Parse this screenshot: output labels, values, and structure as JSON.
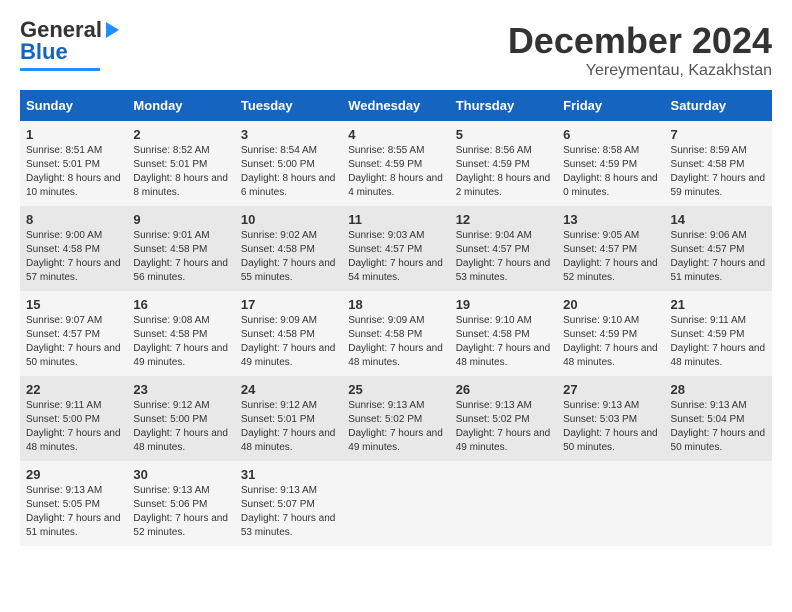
{
  "header": {
    "logo_general": "General",
    "logo_blue": "Blue",
    "month": "December 2024",
    "location": "Yereymentau, Kazakhstan"
  },
  "weekdays": [
    "Sunday",
    "Monday",
    "Tuesday",
    "Wednesday",
    "Thursday",
    "Friday",
    "Saturday"
  ],
  "weeks": [
    [
      {
        "day": "1",
        "sunrise": "8:51 AM",
        "sunset": "5:01 PM",
        "daylight": "8 hours and 10 minutes."
      },
      {
        "day": "2",
        "sunrise": "8:52 AM",
        "sunset": "5:01 PM",
        "daylight": "8 hours and 8 minutes."
      },
      {
        "day": "3",
        "sunrise": "8:54 AM",
        "sunset": "5:00 PM",
        "daylight": "8 hours and 6 minutes."
      },
      {
        "day": "4",
        "sunrise": "8:55 AM",
        "sunset": "4:59 PM",
        "daylight": "8 hours and 4 minutes."
      },
      {
        "day": "5",
        "sunrise": "8:56 AM",
        "sunset": "4:59 PM",
        "daylight": "8 hours and 2 minutes."
      },
      {
        "day": "6",
        "sunrise": "8:58 AM",
        "sunset": "4:59 PM",
        "daylight": "8 hours and 0 minutes."
      },
      {
        "day": "7",
        "sunrise": "8:59 AM",
        "sunset": "4:58 PM",
        "daylight": "7 hours and 59 minutes."
      }
    ],
    [
      {
        "day": "8",
        "sunrise": "9:00 AM",
        "sunset": "4:58 PM",
        "daylight": "7 hours and 57 minutes."
      },
      {
        "day": "9",
        "sunrise": "9:01 AM",
        "sunset": "4:58 PM",
        "daylight": "7 hours and 56 minutes."
      },
      {
        "day": "10",
        "sunrise": "9:02 AM",
        "sunset": "4:58 PM",
        "daylight": "7 hours and 55 minutes."
      },
      {
        "day": "11",
        "sunrise": "9:03 AM",
        "sunset": "4:57 PM",
        "daylight": "7 hours and 54 minutes."
      },
      {
        "day": "12",
        "sunrise": "9:04 AM",
        "sunset": "4:57 PM",
        "daylight": "7 hours and 53 minutes."
      },
      {
        "day": "13",
        "sunrise": "9:05 AM",
        "sunset": "4:57 PM",
        "daylight": "7 hours and 52 minutes."
      },
      {
        "day": "14",
        "sunrise": "9:06 AM",
        "sunset": "4:57 PM",
        "daylight": "7 hours and 51 minutes."
      }
    ],
    [
      {
        "day": "15",
        "sunrise": "9:07 AM",
        "sunset": "4:57 PM",
        "daylight": "7 hours and 50 minutes."
      },
      {
        "day": "16",
        "sunrise": "9:08 AM",
        "sunset": "4:58 PM",
        "daylight": "7 hours and 49 minutes."
      },
      {
        "day": "17",
        "sunrise": "9:09 AM",
        "sunset": "4:58 PM",
        "daylight": "7 hours and 49 minutes."
      },
      {
        "day": "18",
        "sunrise": "9:09 AM",
        "sunset": "4:58 PM",
        "daylight": "7 hours and 48 minutes."
      },
      {
        "day": "19",
        "sunrise": "9:10 AM",
        "sunset": "4:58 PM",
        "daylight": "7 hours and 48 minutes."
      },
      {
        "day": "20",
        "sunrise": "9:10 AM",
        "sunset": "4:59 PM",
        "daylight": "7 hours and 48 minutes."
      },
      {
        "day": "21",
        "sunrise": "9:11 AM",
        "sunset": "4:59 PM",
        "daylight": "7 hours and 48 minutes."
      }
    ],
    [
      {
        "day": "22",
        "sunrise": "9:11 AM",
        "sunset": "5:00 PM",
        "daylight": "7 hours and 48 minutes."
      },
      {
        "day": "23",
        "sunrise": "9:12 AM",
        "sunset": "5:00 PM",
        "daylight": "7 hours and 48 minutes."
      },
      {
        "day": "24",
        "sunrise": "9:12 AM",
        "sunset": "5:01 PM",
        "daylight": "7 hours and 48 minutes."
      },
      {
        "day": "25",
        "sunrise": "9:13 AM",
        "sunset": "5:02 PM",
        "daylight": "7 hours and 49 minutes."
      },
      {
        "day": "26",
        "sunrise": "9:13 AM",
        "sunset": "5:02 PM",
        "daylight": "7 hours and 49 minutes."
      },
      {
        "day": "27",
        "sunrise": "9:13 AM",
        "sunset": "5:03 PM",
        "daylight": "7 hours and 50 minutes."
      },
      {
        "day": "28",
        "sunrise": "9:13 AM",
        "sunset": "5:04 PM",
        "daylight": "7 hours and 50 minutes."
      }
    ],
    [
      {
        "day": "29",
        "sunrise": "9:13 AM",
        "sunset": "5:05 PM",
        "daylight": "7 hours and 51 minutes."
      },
      {
        "day": "30",
        "sunrise": "9:13 AM",
        "sunset": "5:06 PM",
        "daylight": "7 hours and 52 minutes."
      },
      {
        "day": "31",
        "sunrise": "9:13 AM",
        "sunset": "5:07 PM",
        "daylight": "7 hours and 53 minutes."
      },
      null,
      null,
      null,
      null
    ]
  ]
}
